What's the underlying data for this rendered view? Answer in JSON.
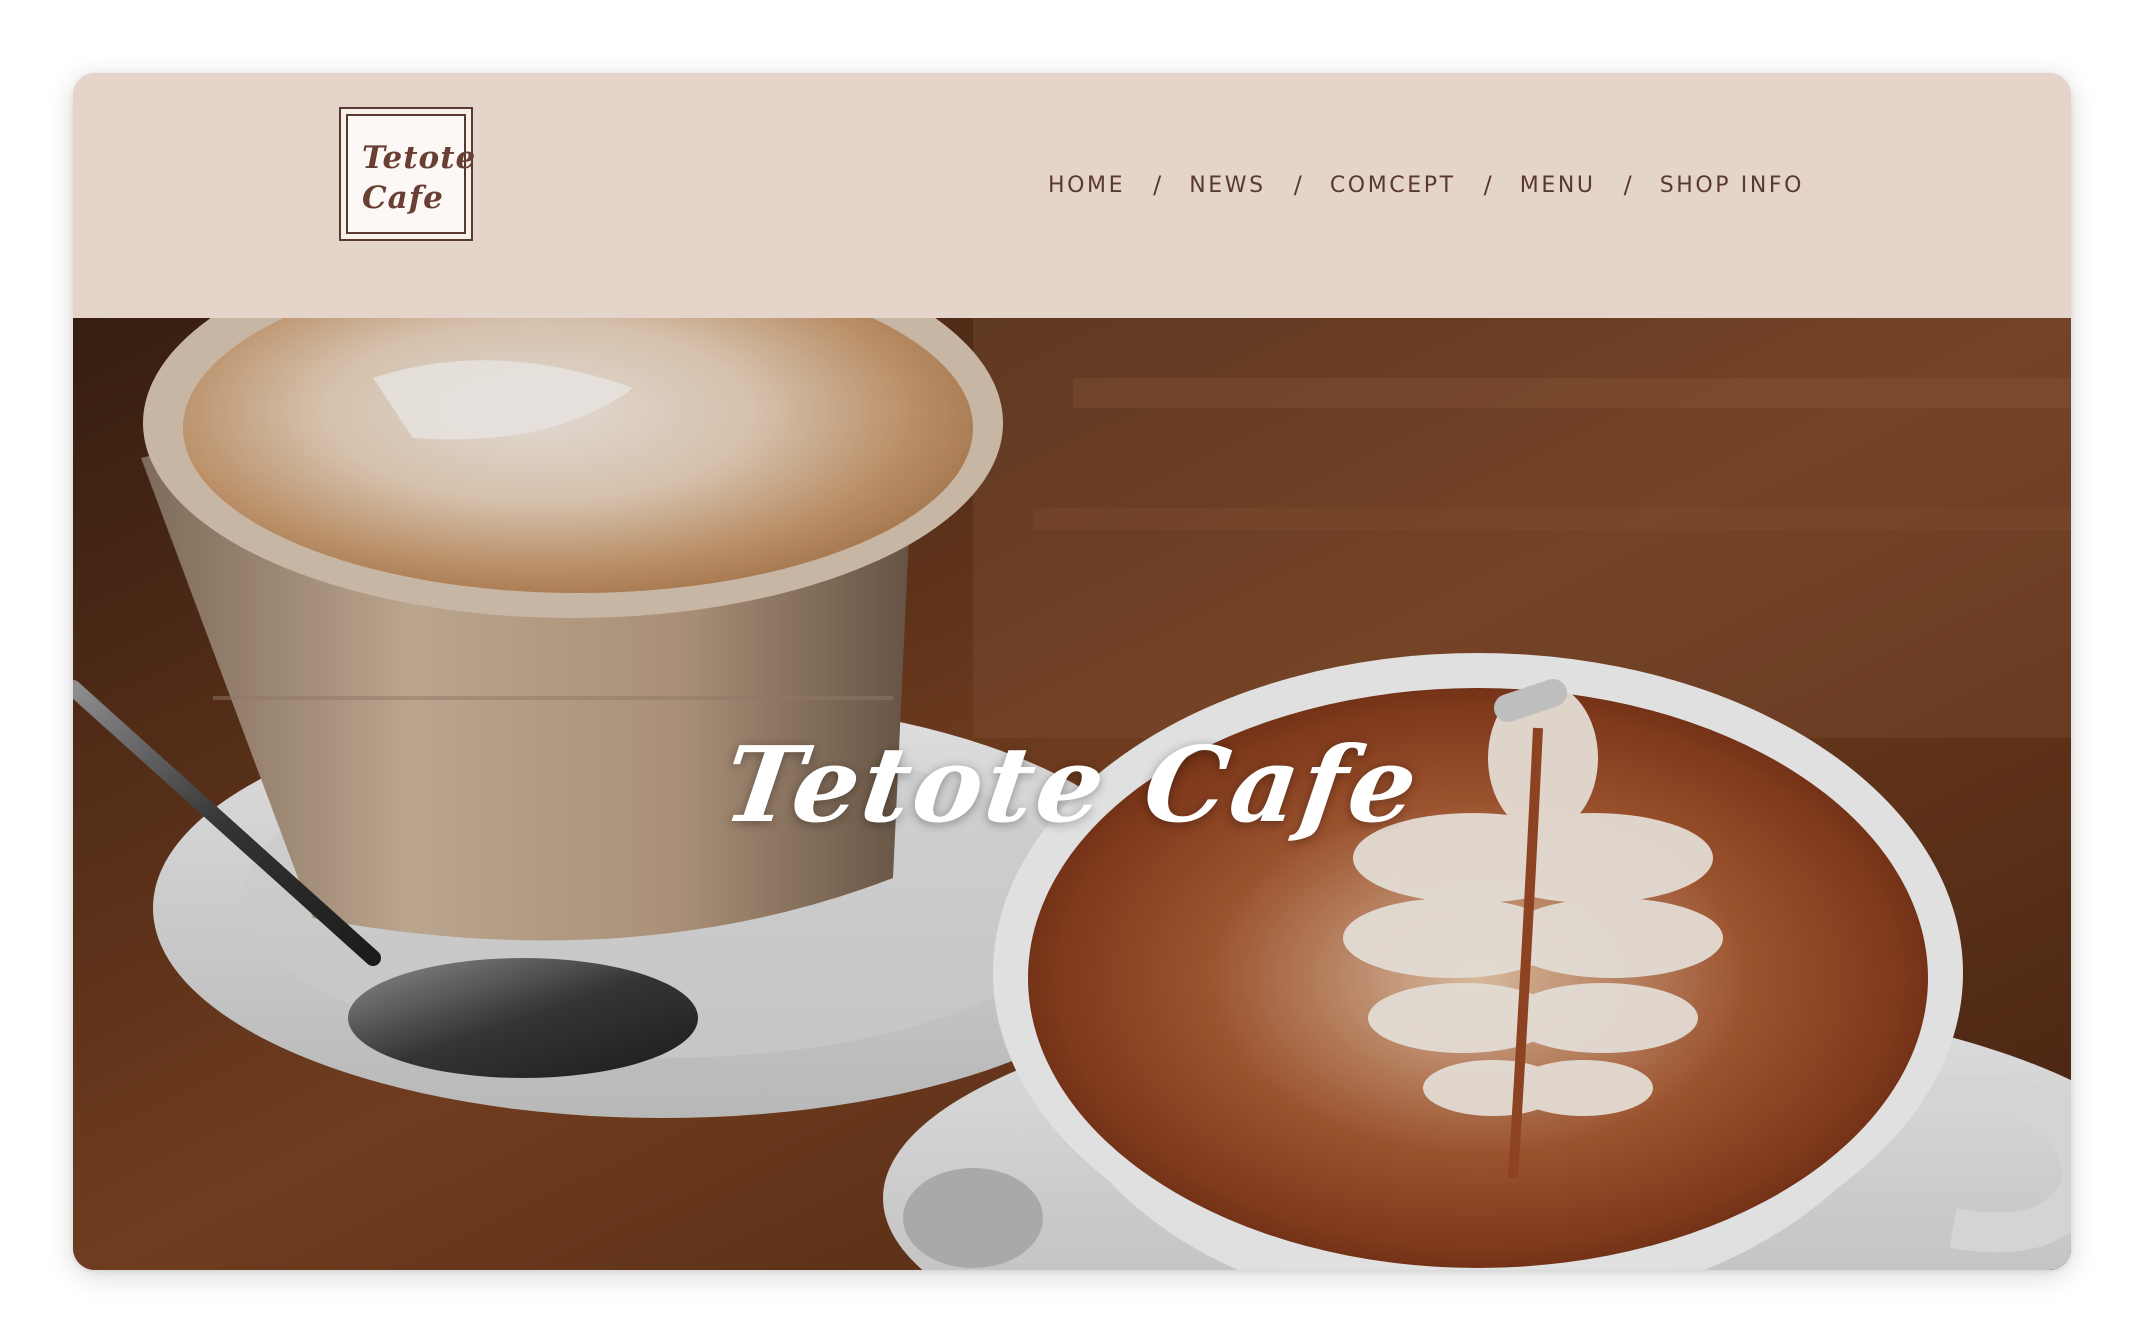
{
  "logo": {
    "line1": "Tetote",
    "line2": "Cafe"
  },
  "nav": {
    "items": [
      {
        "label": "HOME"
      },
      {
        "label": "NEWS"
      },
      {
        "label": "COMCEPT"
      },
      {
        "label": "MENU"
      },
      {
        "label": "SHOP INFO"
      }
    ],
    "separator": "/"
  },
  "hero": {
    "title": "Tetote Cafe"
  },
  "colors": {
    "header_bg": "#e4d4c9",
    "nav_text": "#5a3a30",
    "hero_title": "#ffffff"
  }
}
